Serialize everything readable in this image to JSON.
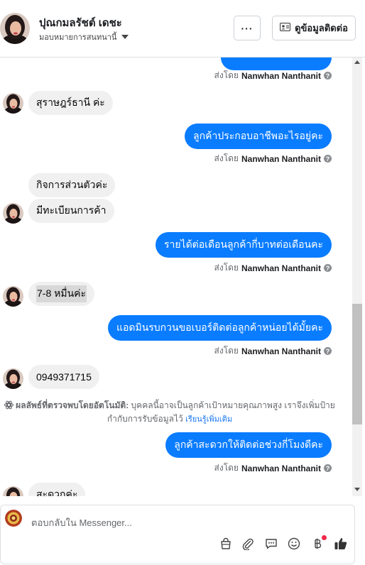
{
  "header": {
    "contact_name": "ปุณกมลรัชต์ เดชะ",
    "assign_label": "มอบหมายการสนทนานี้",
    "more_label": "···",
    "contact_info_label": "ดูข้อมูลติดต่อ"
  },
  "messages": {
    "sent_prefix": "ส่งโดย",
    "agent_name": "Nanwhan Nanthanit",
    "help_glyph": "?",
    "in1": "สุราษฎร์ธานี ค่ะ",
    "out1": "ลูกค้าประกอบอาชีพอะไรอยู่คะ",
    "in2": "กิจการส่วนตัวค่ะ",
    "in3": "มีทะเบียนการค้า",
    "out2": "รายได้ต่อเดือนลูกค้ากี่บาทต่อเดือนคะ",
    "in4": "7-8 หมื่นค่ะ",
    "out3": "แอดมินรบกวนขอเบอร์ติดต่อลูกค้าหน่อยได้มั้ยคะ",
    "in5": "0949371715",
    "out4": "ลูกค้าสะดวกให้ติดต่อช่วงกี่โมงดีคะ",
    "in6": "สะดวกค่ะ"
  },
  "ai_note": {
    "heading": "ผลลัพธ์ที่ตรวจพบโดยอัตโนมัติ:",
    "body": "บุคคลนี้อาจเป็นลูกค้าเป้าหมายคุณภาพสูง เราจึงเพิ่มป้ายกำกับการรับข้อมูลไว้",
    "learn_more": "เรียนรู้เพิ่มเติม"
  },
  "composer": {
    "placeholder": "ตอบกลับใน Messenger..."
  },
  "colors": {
    "brand_blue": "#0a7cff",
    "incoming_bubble": "#f0f0f0",
    "notification_red": "#f02849"
  },
  "icons": [
    "contact-card-icon",
    "chevron-down-icon",
    "ai-detect-icon",
    "bag-icon",
    "paperclip-icon",
    "saved-reply-icon",
    "emoji-icon",
    "baht-icon",
    "thumbs-up-icon"
  ]
}
